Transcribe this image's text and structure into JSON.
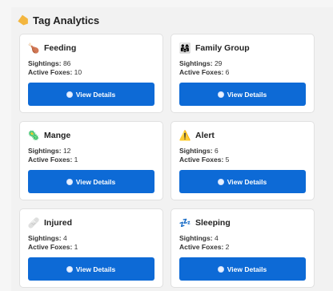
{
  "section": {
    "title": "Tag Analytics",
    "icon": "tag-icon"
  },
  "labels": {
    "sightings": "Sightings:",
    "active_foxes": "Active Foxes:",
    "view_details": "View Details"
  },
  "tags": [
    {
      "name": "Feeding",
      "icon": "drumstick-icon",
      "glyph": "🍗",
      "sightings": "86",
      "active_foxes": "10"
    },
    {
      "name": "Family Group",
      "icon": "family-icon",
      "glyph": "👨‍👩‍👧",
      "sightings": "29",
      "active_foxes": "6"
    },
    {
      "name": "Mange",
      "icon": "microbe-icon",
      "glyph": "🦠",
      "sightings": "12",
      "active_foxes": "1"
    },
    {
      "name": "Alert",
      "icon": "warning-icon",
      "glyph": "⚠️",
      "sightings": "6",
      "active_foxes": "5"
    },
    {
      "name": "Injured",
      "icon": "bandage-icon",
      "glyph": "🩹",
      "sightings": "4",
      "active_foxes": "1"
    },
    {
      "name": "Sleeping",
      "icon": "sleep-icon",
      "glyph": "💤",
      "sightings": "4",
      "active_foxes": "2"
    }
  ],
  "colors": {
    "button": "#0d6ad6",
    "card_bg": "#ffffff",
    "page_bg": "#f6f6f6"
  }
}
